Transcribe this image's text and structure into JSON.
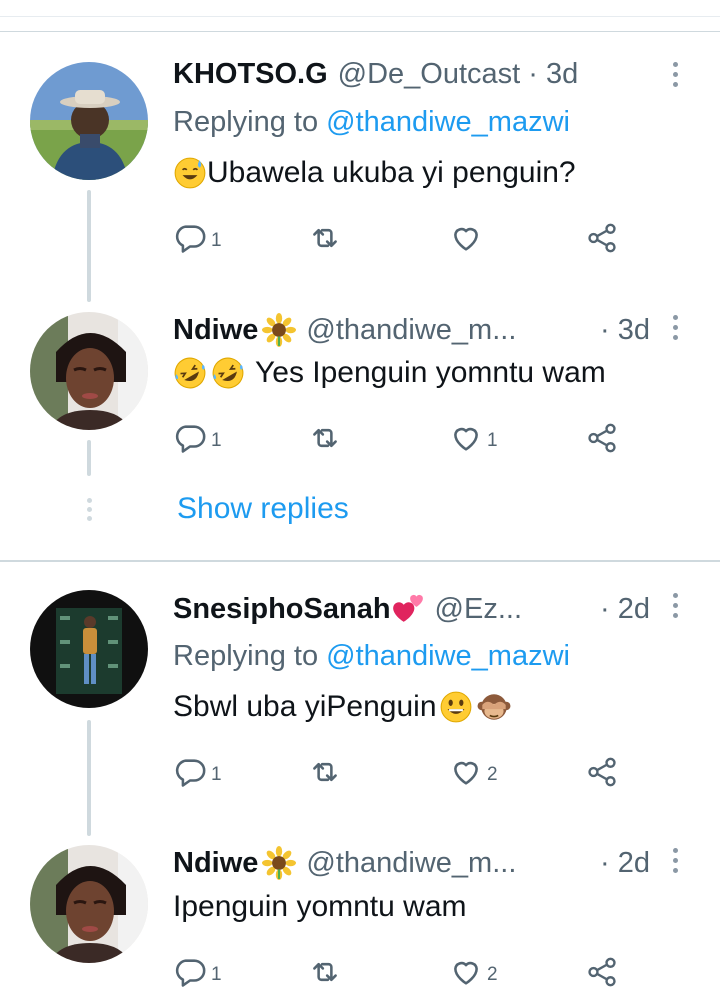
{
  "colors": {
    "accent": "#1d9bf0",
    "text": "#0f1419",
    "muted": "#536471",
    "divider": "#cfd9de"
  },
  "tweets": [
    {
      "name": "KHOTSO.G",
      "handle": "@De_Outcast",
      "time": "· 3d",
      "replying_label": "Replying to",
      "replying_to": "@thandiwe_mazwi",
      "text": "Ubawela ukuba yi penguin?",
      "text_emojis": [
        "sweat-smile-emoji"
      ],
      "replies": "1",
      "retweets": "",
      "likes": ""
    },
    {
      "name": "Ndiwe",
      "name_emoji": "sunflower-emoji",
      "handle": "@thandiwe_m...",
      "time": "· 3d",
      "text": "Yes Ipenguin yomntu wam",
      "text_emojis": [
        "rofl-emoji",
        "rofl-emoji"
      ],
      "replies": "1",
      "retweets": "",
      "likes": "1"
    },
    {
      "name": "SnesiphoSanah",
      "name_emoji": "two-hearts-emoji",
      "handle": "@Ez...",
      "time": "· 2d",
      "replying_label": "Replying to",
      "replying_to": "@thandiwe_mazwi",
      "text": "Sbwl uba yiPenguin",
      "text_emojis": [
        "grinning-emoji",
        "see-no-evil-monkey-emoji"
      ],
      "replies": "1",
      "retweets": "",
      "likes": "2"
    },
    {
      "name": "Ndiwe",
      "name_emoji": "sunflower-emoji",
      "handle": "@thandiwe_m...",
      "time": "· 2d",
      "text": "Ipenguin yomntu wam",
      "replies": "1",
      "retweets": "",
      "likes": "2"
    }
  ],
  "show_replies_label": "Show replies"
}
